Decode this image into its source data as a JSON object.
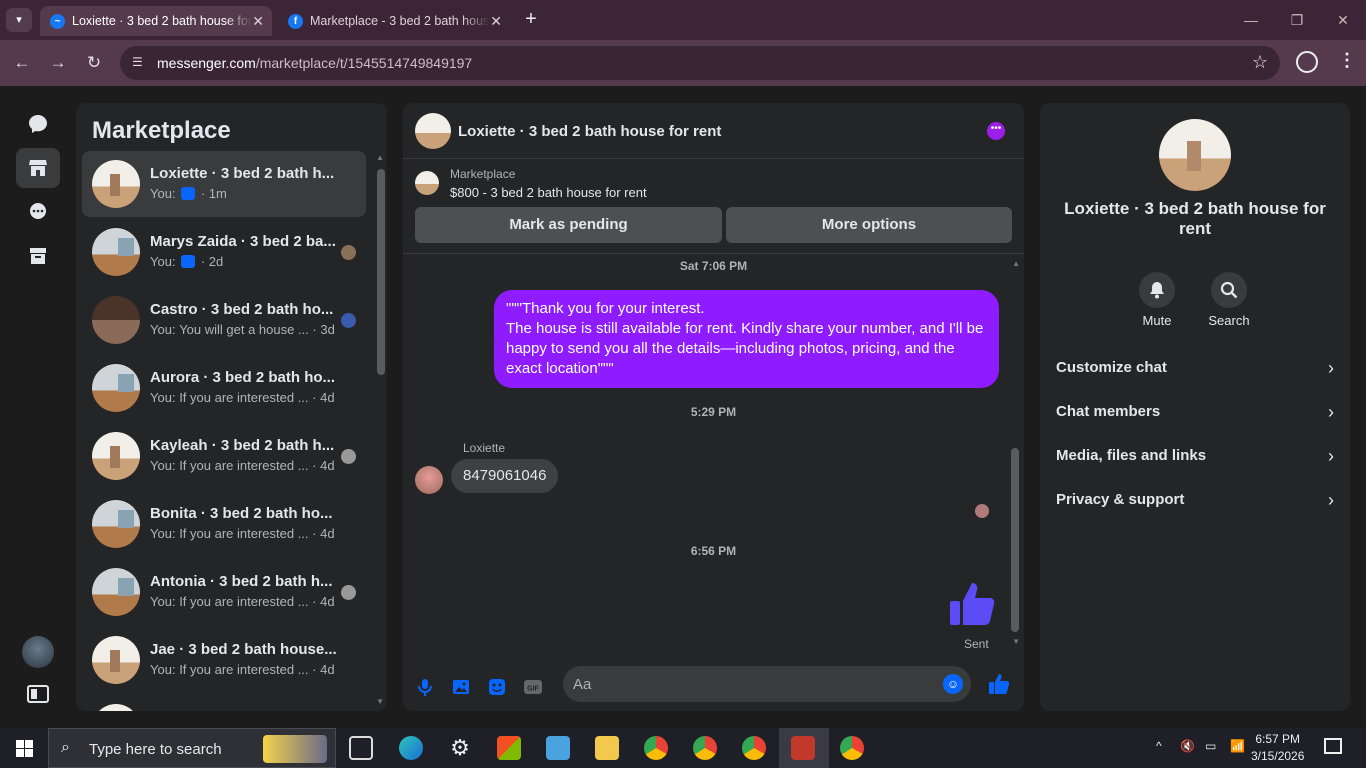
{
  "browser": {
    "tabs": [
      {
        "title": "Loxiette · 3 bed 2 bath house for rent",
        "favicon": "messenger-icon",
        "active": true
      },
      {
        "title": "Marketplace - 3 bed 2 bath house for rent",
        "favicon": "facebook-icon",
        "active": false
      }
    ],
    "url_domain": "messenger.com",
    "url_path": "/marketplace/t/1545514749849197"
  },
  "list": {
    "title": "Marketplace",
    "conversations": [
      {
        "title": "Loxiette · 3 bed 2 bath h...",
        "prefix": "You:",
        "snippet": "",
        "like": true,
        "time": "· 1m"
      },
      {
        "title": "Marys Zaida · 3 bed 2 ba...",
        "prefix": "You:",
        "snippet": "",
        "like": true,
        "time": "· 2d"
      },
      {
        "title": "Castro · 3 bed 2 bath ho...",
        "prefix": "You:",
        "snippet": "You will get a house ...",
        "like": false,
        "time": "· 3d"
      },
      {
        "title": "Aurora · 3 bed 2 bath ho...",
        "prefix": "You:",
        "snippet": "If you are interested ...",
        "like": false,
        "time": "· 4d"
      },
      {
        "title": "Kayleah · 3 bed 2 bath h...",
        "prefix": "You:",
        "snippet": "If you are interested ...",
        "like": false,
        "time": "· 4d"
      },
      {
        "title": "Bonita · 3 bed 2 bath ho...",
        "prefix": "You:",
        "snippet": "If you are interested ...",
        "like": false,
        "time": "· 4d"
      },
      {
        "title": "Antonia · 3 bed 2 bath h...",
        "prefix": "You:",
        "snippet": "If you are interested ...",
        "like": false,
        "time": "· 4d"
      },
      {
        "title": "Jae · 3 bed 2 bath house...",
        "prefix": "You:",
        "snippet": "If you are interested ...",
        "like": false,
        "time": "· 4d"
      }
    ]
  },
  "chat": {
    "title": "Loxiette · 3 bed 2 bath house for rent",
    "marketplace_label": "Marketplace",
    "listing": "$800 - 3 bed 2 bath house for rent",
    "mark_pending": "Mark as pending",
    "more_options": "More options",
    "ts1": "Sat 7:06 PM",
    "outgoing_message": "\"\"\"Thank you for your interest.\nThe house is still available for rent. Kindly share your number, and I'll be happy to send you all the details—including photos, pricing, and the exact location\"\"\"",
    "ts2": "5:29 PM",
    "sender_name": "Loxiette",
    "incoming_message": "8479061046",
    "ts3": "6:56 PM",
    "sent_label": "Sent",
    "input_placeholder": "Aa"
  },
  "info": {
    "name": "Loxiette · 3 bed 2 bath house for rent",
    "mute": "Mute",
    "search": "Search",
    "options": [
      "Customize chat",
      "Chat members",
      "Media, files and links",
      "Privacy & support"
    ]
  },
  "taskbar": {
    "search_placeholder": "Type here to search",
    "time": "6:57 PM",
    "date": "3/15/2026"
  },
  "colors": {
    "accent_purple": "#8f1bff",
    "messenger_blue": "#0866ff",
    "chrome_frame": "#543a4c"
  }
}
